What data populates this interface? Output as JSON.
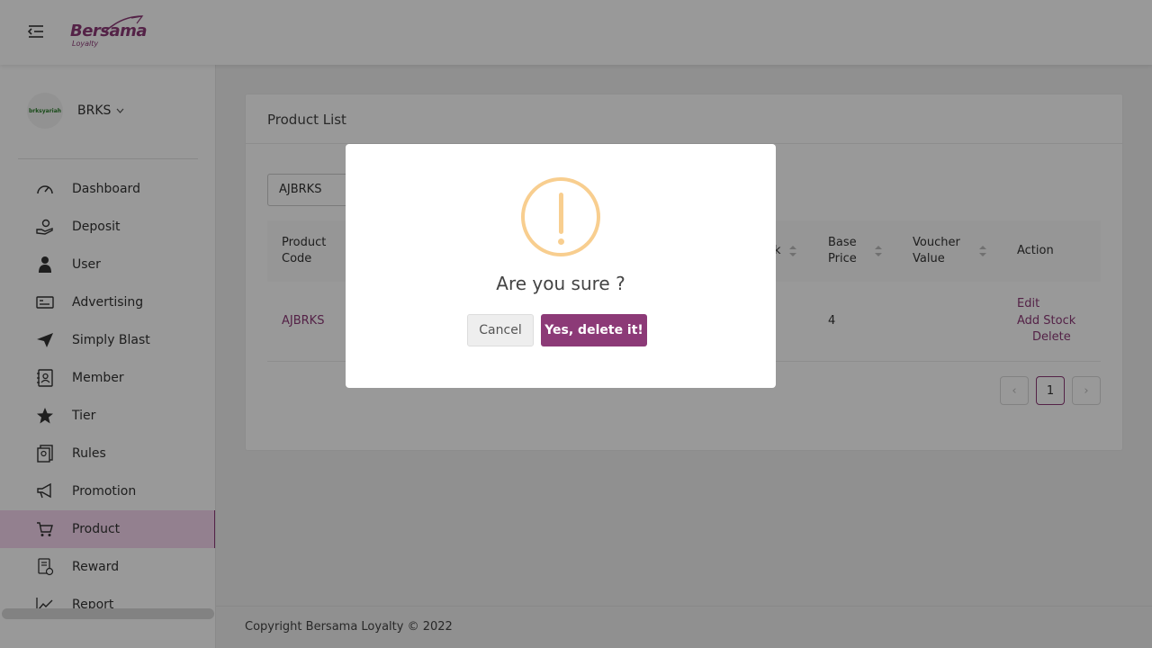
{
  "header": {
    "logo_text": "Bersama",
    "logo_sub": "Loyalty"
  },
  "sidebar": {
    "account": {
      "avatar_text": "brksyariah",
      "name": "BRKS"
    },
    "items": [
      {
        "label": "Dashboard",
        "icon": "dashboard-gauge-icon"
      },
      {
        "label": "Deposit",
        "icon": "deposit-hand-icon"
      },
      {
        "label": "User",
        "icon": "user-icon"
      },
      {
        "label": "Advertising",
        "icon": "advertising-card-icon"
      },
      {
        "label": "Simply Blast",
        "icon": "paper-plane-icon"
      },
      {
        "label": "Member",
        "icon": "member-contact-icon"
      },
      {
        "label": "Tier",
        "icon": "star-icon"
      },
      {
        "label": "Rules",
        "icon": "rules-book-icon"
      },
      {
        "label": "Promotion",
        "icon": "megaphone-icon"
      },
      {
        "label": "Product",
        "icon": "cart-icon"
      },
      {
        "label": "Reward",
        "icon": "reward-icon"
      },
      {
        "label": "Report",
        "icon": "chart-line-icon"
      }
    ],
    "active_item": "Product"
  },
  "main": {
    "card_title": "Product List",
    "search_value": "AJBRKS",
    "table": {
      "columns": [
        {
          "label": "Product Code",
          "line1": "Product",
          "line2": "Code"
        },
        {
          "label": "Base Price",
          "line1": "Base",
          "line2": "Price"
        },
        {
          "label": "Voucher Value",
          "line1": "Voucher",
          "line2": "Value"
        },
        {
          "label": "Action",
          "line1": "Action",
          "line2": ""
        }
      ],
      "partial_column_char": "k",
      "rows": [
        {
          "product_code": "AJBRKS",
          "base_price": "4",
          "voucher_value": "",
          "actions": {
            "edit": "Edit",
            "add_stock": "Add Stock",
            "delete": "Delete"
          }
        }
      ]
    },
    "pagination": {
      "prev": "‹",
      "current": "1",
      "next": "›"
    }
  },
  "footer": {
    "copyright": "Copyright Bersama Loyalty © 2022"
  },
  "modal": {
    "icon": "warning-exclamation-icon",
    "title": "Are you sure ?",
    "cancel_label": "Cancel",
    "confirm_label": "Yes, delete it!"
  },
  "colors": {
    "brand": "#8c3a77",
    "warning": "#f8ce8f",
    "active_menu_bg": "#f5d6ee"
  }
}
